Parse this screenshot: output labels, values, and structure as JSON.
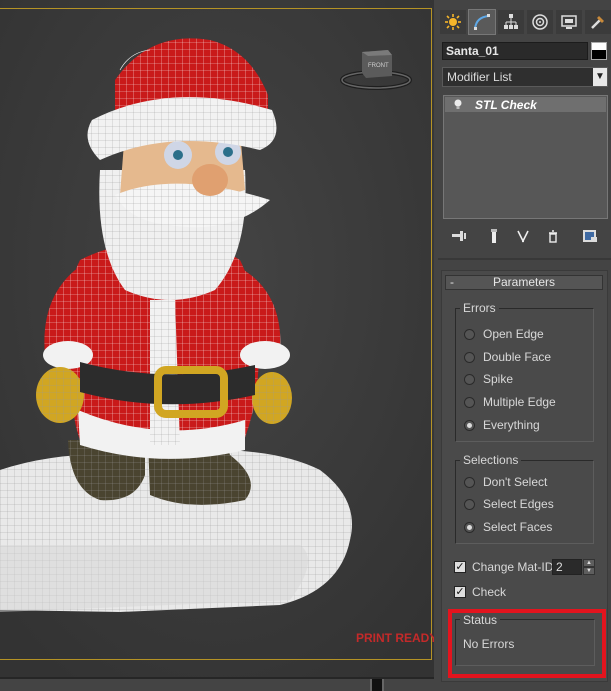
{
  "viewport": {
    "overlay_text": "PRINT READY!",
    "viewcube_label": "FRONT"
  },
  "command_panel": {
    "tabs": [
      "create-icon",
      "modify-icon",
      "hierarchy-icon",
      "motion-icon",
      "display-icon",
      "utilities-icon"
    ],
    "object_name": "Santa_01",
    "object_color": "#000000",
    "modifier_list": "Modifier List",
    "modifier_stack": [
      {
        "label": "STL Check"
      }
    ],
    "stack_tools": [
      "pin-stack-icon",
      "show-end-result-icon",
      "make-unique-icon",
      "remove-modifier-icon",
      "configure-sets-icon"
    ]
  },
  "parameters": {
    "title": "Parameters",
    "toggle": "-",
    "errors": {
      "title": "Errors",
      "options": [
        {
          "label": "Open Edge",
          "checked": false
        },
        {
          "label": "Double Face",
          "checked": false
        },
        {
          "label": "Spike",
          "checked": false
        },
        {
          "label": "Multiple Edge",
          "checked": false
        },
        {
          "label": "Everything",
          "checked": true
        }
      ]
    },
    "selections": {
      "title": "Selections",
      "options": [
        {
          "label": "Don't Select",
          "checked": false
        },
        {
          "label": "Select Edges",
          "checked": false
        },
        {
          "label": "Select Faces",
          "checked": true
        }
      ]
    },
    "change_mat_id": {
      "label": "Change Mat-ID",
      "checked": true,
      "value": "2"
    },
    "check": {
      "label": "Check",
      "checked": true
    },
    "status": {
      "title": "Status",
      "text": "No Errors"
    }
  },
  "colors": {
    "highlight": "#e3141e",
    "overlay_text": "#c42a2a",
    "viewport_border": "#b59325"
  }
}
